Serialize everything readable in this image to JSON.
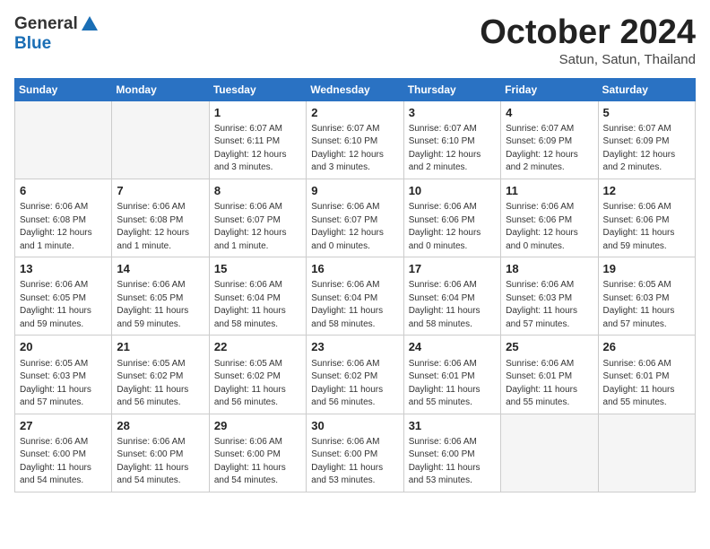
{
  "header": {
    "logo_general": "General",
    "logo_blue": "Blue",
    "month": "October 2024",
    "location": "Satun, Satun, Thailand"
  },
  "weekdays": [
    "Sunday",
    "Monday",
    "Tuesday",
    "Wednesday",
    "Thursday",
    "Friday",
    "Saturday"
  ],
  "weeks": [
    [
      {
        "day": "",
        "detail": ""
      },
      {
        "day": "",
        "detail": ""
      },
      {
        "day": "1",
        "detail": "Sunrise: 6:07 AM\nSunset: 6:11 PM\nDaylight: 12 hours and 3 minutes."
      },
      {
        "day": "2",
        "detail": "Sunrise: 6:07 AM\nSunset: 6:10 PM\nDaylight: 12 hours and 3 minutes."
      },
      {
        "day": "3",
        "detail": "Sunrise: 6:07 AM\nSunset: 6:10 PM\nDaylight: 12 hours and 2 minutes."
      },
      {
        "day": "4",
        "detail": "Sunrise: 6:07 AM\nSunset: 6:09 PM\nDaylight: 12 hours and 2 minutes."
      },
      {
        "day": "5",
        "detail": "Sunrise: 6:07 AM\nSunset: 6:09 PM\nDaylight: 12 hours and 2 minutes."
      }
    ],
    [
      {
        "day": "6",
        "detail": "Sunrise: 6:06 AM\nSunset: 6:08 PM\nDaylight: 12 hours and 1 minute."
      },
      {
        "day": "7",
        "detail": "Sunrise: 6:06 AM\nSunset: 6:08 PM\nDaylight: 12 hours and 1 minute."
      },
      {
        "day": "8",
        "detail": "Sunrise: 6:06 AM\nSunset: 6:07 PM\nDaylight: 12 hours and 1 minute."
      },
      {
        "day": "9",
        "detail": "Sunrise: 6:06 AM\nSunset: 6:07 PM\nDaylight: 12 hours and 0 minutes."
      },
      {
        "day": "10",
        "detail": "Sunrise: 6:06 AM\nSunset: 6:06 PM\nDaylight: 12 hours and 0 minutes."
      },
      {
        "day": "11",
        "detail": "Sunrise: 6:06 AM\nSunset: 6:06 PM\nDaylight: 12 hours and 0 minutes."
      },
      {
        "day": "12",
        "detail": "Sunrise: 6:06 AM\nSunset: 6:06 PM\nDaylight: 11 hours and 59 minutes."
      }
    ],
    [
      {
        "day": "13",
        "detail": "Sunrise: 6:06 AM\nSunset: 6:05 PM\nDaylight: 11 hours and 59 minutes."
      },
      {
        "day": "14",
        "detail": "Sunrise: 6:06 AM\nSunset: 6:05 PM\nDaylight: 11 hours and 59 minutes."
      },
      {
        "day": "15",
        "detail": "Sunrise: 6:06 AM\nSunset: 6:04 PM\nDaylight: 11 hours and 58 minutes."
      },
      {
        "day": "16",
        "detail": "Sunrise: 6:06 AM\nSunset: 6:04 PM\nDaylight: 11 hours and 58 minutes."
      },
      {
        "day": "17",
        "detail": "Sunrise: 6:06 AM\nSunset: 6:04 PM\nDaylight: 11 hours and 58 minutes."
      },
      {
        "day": "18",
        "detail": "Sunrise: 6:06 AM\nSunset: 6:03 PM\nDaylight: 11 hours and 57 minutes."
      },
      {
        "day": "19",
        "detail": "Sunrise: 6:05 AM\nSunset: 6:03 PM\nDaylight: 11 hours and 57 minutes."
      }
    ],
    [
      {
        "day": "20",
        "detail": "Sunrise: 6:05 AM\nSunset: 6:03 PM\nDaylight: 11 hours and 57 minutes."
      },
      {
        "day": "21",
        "detail": "Sunrise: 6:05 AM\nSunset: 6:02 PM\nDaylight: 11 hours and 56 minutes."
      },
      {
        "day": "22",
        "detail": "Sunrise: 6:05 AM\nSunset: 6:02 PM\nDaylight: 11 hours and 56 minutes."
      },
      {
        "day": "23",
        "detail": "Sunrise: 6:06 AM\nSunset: 6:02 PM\nDaylight: 11 hours and 56 minutes."
      },
      {
        "day": "24",
        "detail": "Sunrise: 6:06 AM\nSunset: 6:01 PM\nDaylight: 11 hours and 55 minutes."
      },
      {
        "day": "25",
        "detail": "Sunrise: 6:06 AM\nSunset: 6:01 PM\nDaylight: 11 hours and 55 minutes."
      },
      {
        "day": "26",
        "detail": "Sunrise: 6:06 AM\nSunset: 6:01 PM\nDaylight: 11 hours and 55 minutes."
      }
    ],
    [
      {
        "day": "27",
        "detail": "Sunrise: 6:06 AM\nSunset: 6:00 PM\nDaylight: 11 hours and 54 minutes."
      },
      {
        "day": "28",
        "detail": "Sunrise: 6:06 AM\nSunset: 6:00 PM\nDaylight: 11 hours and 54 minutes."
      },
      {
        "day": "29",
        "detail": "Sunrise: 6:06 AM\nSunset: 6:00 PM\nDaylight: 11 hours and 54 minutes."
      },
      {
        "day": "30",
        "detail": "Sunrise: 6:06 AM\nSunset: 6:00 PM\nDaylight: 11 hours and 53 minutes."
      },
      {
        "day": "31",
        "detail": "Sunrise: 6:06 AM\nSunset: 6:00 PM\nDaylight: 11 hours and 53 minutes."
      },
      {
        "day": "",
        "detail": ""
      },
      {
        "day": "",
        "detail": ""
      }
    ]
  ]
}
